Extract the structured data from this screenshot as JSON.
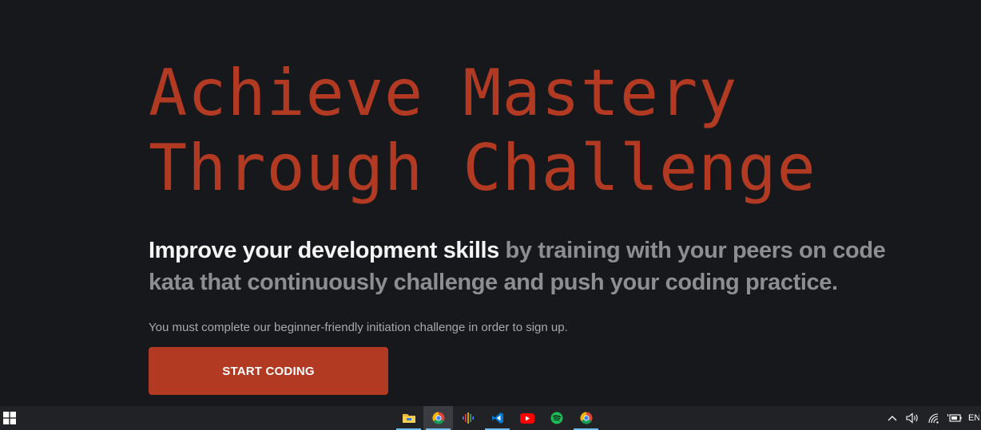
{
  "hero": {
    "headline_line1": "Achieve Mastery",
    "headline_line2": "Through Challenge",
    "subhead_strong": "Improve your development skills",
    "subhead_rest": " by training with your peers on code kata that continuously challenge and push your coding practice.",
    "note": "You must complete our beginner-friendly initiation challenge in order to sign up.",
    "cta_label": "START CODING"
  },
  "colors": {
    "background": "#17181c",
    "accent": "#b23a22",
    "subhead_strong": "#f5f5f5",
    "subhead_muted": "#8d8e92",
    "taskbar": "#212226"
  },
  "taskbar": {
    "start_icon": "windows-logo-icon",
    "apps": [
      {
        "name": "file-explorer-icon",
        "underlined": true,
        "active": false
      },
      {
        "name": "chrome-icon",
        "underlined": true,
        "active": true
      },
      {
        "name": "podcast-app-icon",
        "underlined": false,
        "active": false
      },
      {
        "name": "vscode-icon",
        "underlined": true,
        "active": false
      },
      {
        "name": "youtube-icon",
        "underlined": false,
        "active": false
      },
      {
        "name": "spotify-icon",
        "underlined": false,
        "active": false
      },
      {
        "name": "chrome-icon",
        "underlined": true,
        "active": false
      }
    ],
    "tray": {
      "icons": [
        "chevron-up-icon",
        "volume-icon",
        "wifi-icon",
        "battery-icon"
      ],
      "language": "EN"
    }
  }
}
